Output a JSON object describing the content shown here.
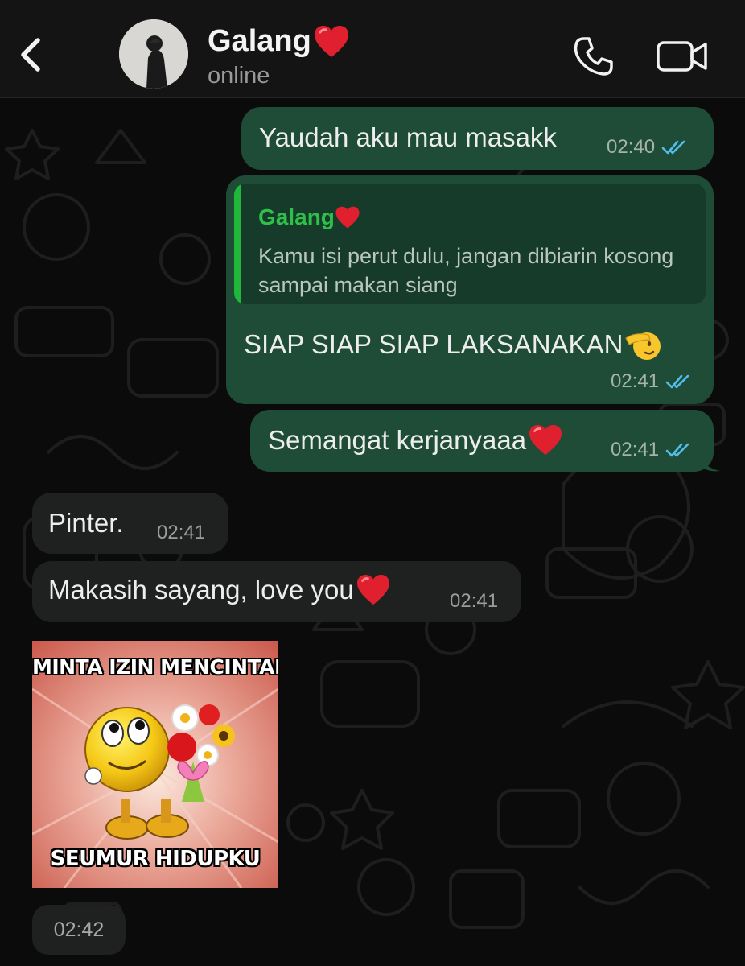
{
  "header": {
    "contact_name": "Galang",
    "status": "online"
  },
  "messages": [
    {
      "direction": "outgoing",
      "text": "Yaudah aku mau masakk",
      "time": "02:40",
      "status": "read"
    },
    {
      "direction": "outgoing",
      "reply_to": {
        "author": "Galang",
        "text": "Kamu isi perut dulu, jangan dibiarin kosong sampai makan siang"
      },
      "text": "SIAP SIAP SIAP LAKSANAKAN",
      "time": "02:41",
      "status": "read"
    },
    {
      "direction": "outgoing",
      "text": "Semangat kerjanyaaa",
      "time": "02:41",
      "status": "read"
    },
    {
      "direction": "incoming",
      "text": "Pinter.",
      "time": "02:41"
    },
    {
      "direction": "incoming",
      "text": "Makasih sayang, love you",
      "time": "02:41"
    },
    {
      "direction": "incoming",
      "type": "sticker",
      "sticker_top": "MINTA IZIN MENCINTAIMU",
      "sticker_bottom": "SEUMUR HIDUPKU",
      "time": "02:42"
    }
  ],
  "icons": {
    "back": "chevron-left-icon",
    "call": "phone-icon",
    "video": "video-camera-icon",
    "read_receipt": "double-check-icon",
    "heart": "red-heart-emoji",
    "salute": "saluting-face-emoji"
  },
  "colors": {
    "outgoing_bubble": "#1e4c36",
    "incoming_bubble": "#1f2020",
    "read_tick": "#53bdeb",
    "quote_accent": "#1fb83a",
    "heart": "#e0202e"
  }
}
